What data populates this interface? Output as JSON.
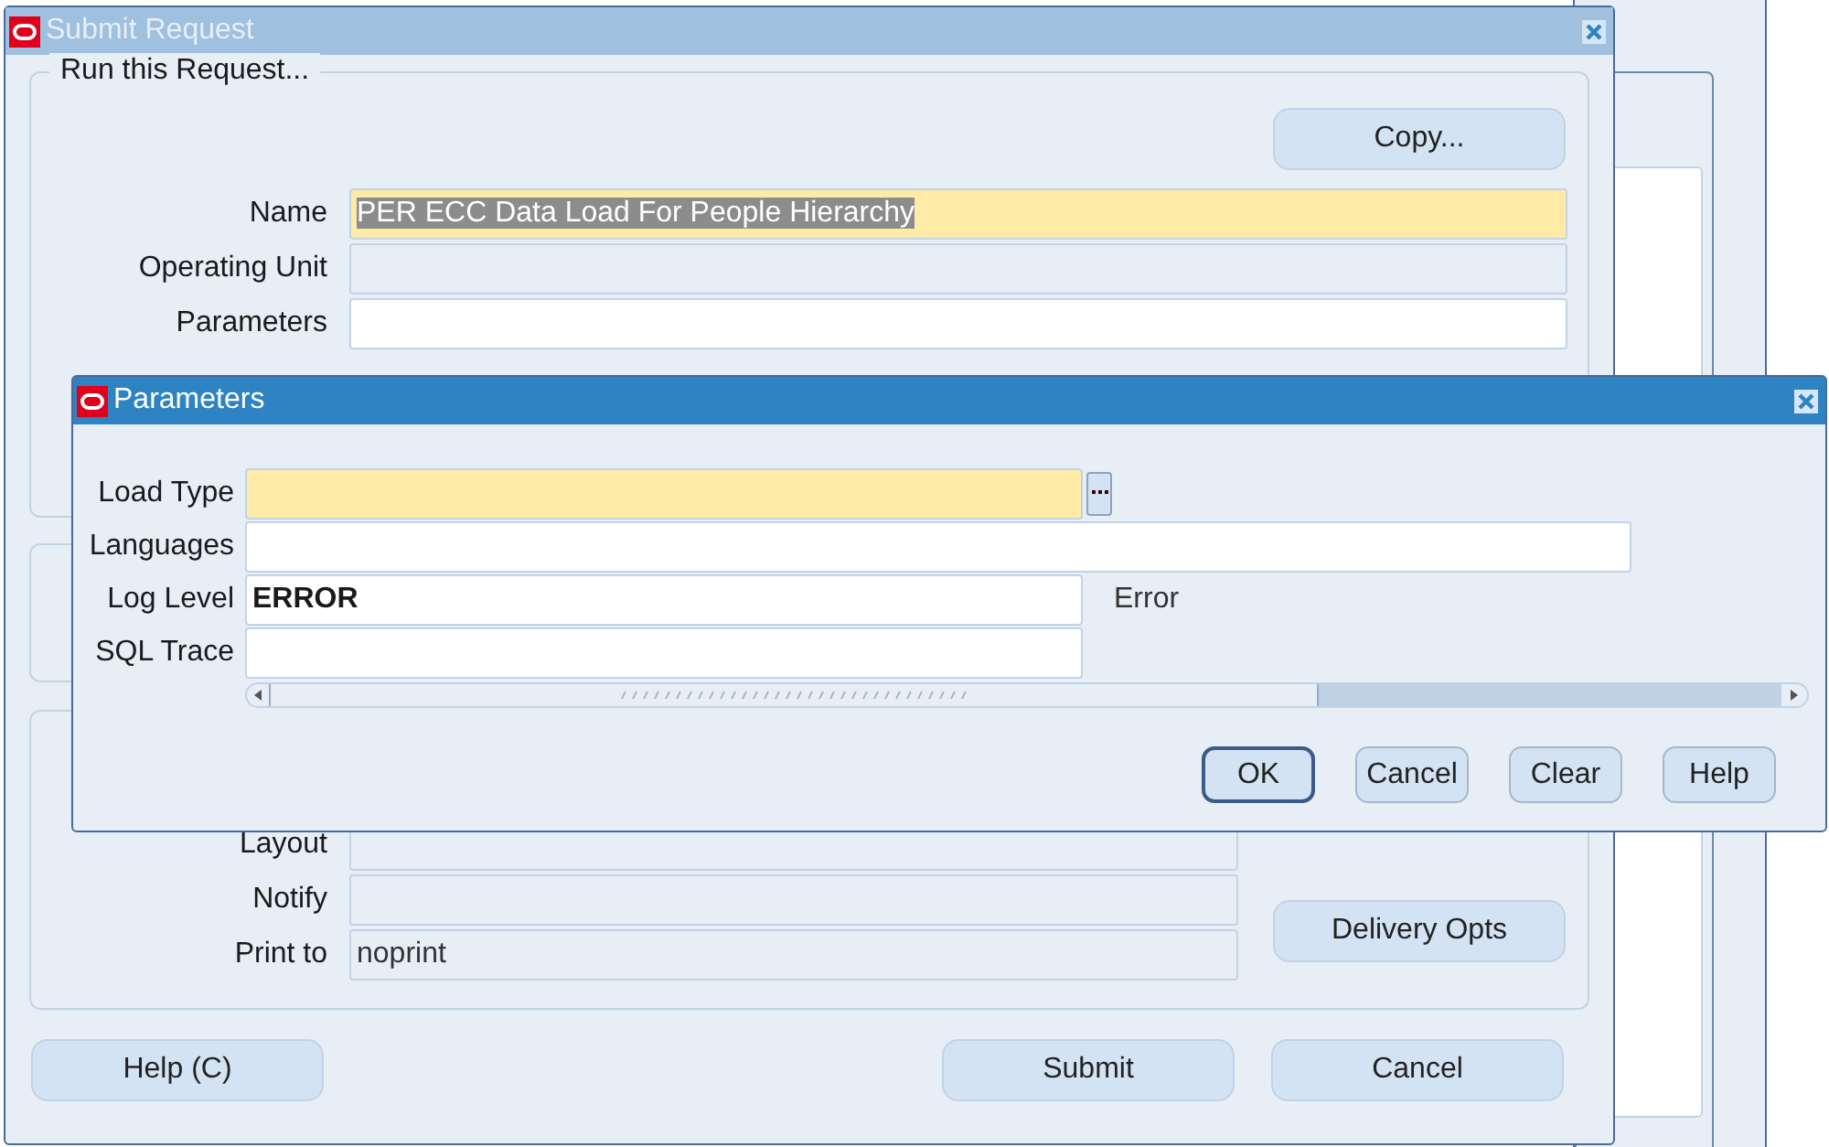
{
  "submit_request": {
    "title": "Submit Request",
    "active": false,
    "group_title": "Run this Request...",
    "copy_button": "Copy...",
    "request_fields": [
      {
        "label": "Name",
        "kind": "required",
        "value": "PER ECC Data Load For People Hierarchy",
        "highlighted": true
      },
      {
        "label": "Operating Unit",
        "kind": "readonly"
      },
      {
        "label": "Parameters",
        "kind": "text"
      }
    ],
    "output_fields": [
      {
        "label": "Layout",
        "kind": "readonly"
      },
      {
        "label": "Notify",
        "kind": "readonly"
      },
      {
        "label": "Print to",
        "kind": "readonly",
        "value": "noprint"
      }
    ],
    "delivery_button": "Delivery Opts",
    "buttons": [
      "Help (C)",
      "Submit",
      "Cancel"
    ]
  },
  "parameters_dialog": {
    "title": "Parameters",
    "active": true,
    "fields": [
      {
        "label": "Load Type",
        "kind": "required",
        "lov": true
      },
      {
        "label": "Languages",
        "kind": "text"
      },
      {
        "label": "Log Level",
        "kind": "text",
        "value": "ERROR",
        "description": "Error"
      },
      {
        "label": "SQL Trace",
        "kind": "text"
      }
    ],
    "buttons": [
      {
        "label": "OK",
        "default": true
      },
      {
        "label": "Cancel",
        "default": false
      },
      {
        "label": "Clear",
        "default": false
      },
      {
        "label": "Help",
        "default": false
      }
    ]
  }
}
